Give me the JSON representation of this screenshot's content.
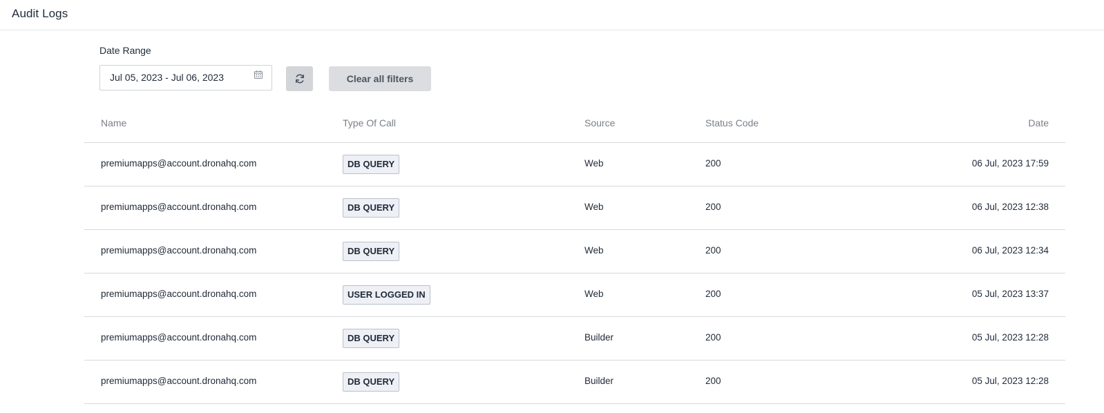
{
  "header": {
    "title": "Audit Logs"
  },
  "filters": {
    "date_range_label": "Date Range",
    "date_range_value": "Jul 05, 2023 - Jul 06, 2023",
    "clear_label": "Clear all filters",
    "refresh_icon": "refresh-icon",
    "calendar_icon": "calendar-icon"
  },
  "table": {
    "columns": [
      "Name",
      "Type Of Call",
      "Source",
      "Status Code",
      "Date"
    ],
    "rows": [
      {
        "name": "premiumapps@account.dronahq.com",
        "type": "DB QUERY",
        "source": "Web",
        "status": "200",
        "date": "06 Jul, 2023 17:59"
      },
      {
        "name": "premiumapps@account.dronahq.com",
        "type": "DB QUERY",
        "source": "Web",
        "status": "200",
        "date": "06 Jul, 2023 12:38"
      },
      {
        "name": "premiumapps@account.dronahq.com",
        "type": "DB QUERY",
        "source": "Web",
        "status": "200",
        "date": "06 Jul, 2023 12:34"
      },
      {
        "name": "premiumapps@account.dronahq.com",
        "type": "USER LOGGED IN",
        "source": "Web",
        "status": "200",
        "date": "05 Jul, 2023 13:37"
      },
      {
        "name": "premiumapps@account.dronahq.com",
        "type": "DB QUERY",
        "source": "Builder",
        "status": "200",
        "date": "05 Jul, 2023 12:28"
      },
      {
        "name": "premiumapps@account.dronahq.com",
        "type": "DB QUERY",
        "source": "Builder",
        "status": "200",
        "date": "05 Jul, 2023 12:28"
      }
    ]
  },
  "colors": {
    "badge_bg": "#eef0f6",
    "badge_border": "#b9bfcc",
    "button_bg": "#d3d5d9",
    "divider": "#d5d8dc"
  }
}
